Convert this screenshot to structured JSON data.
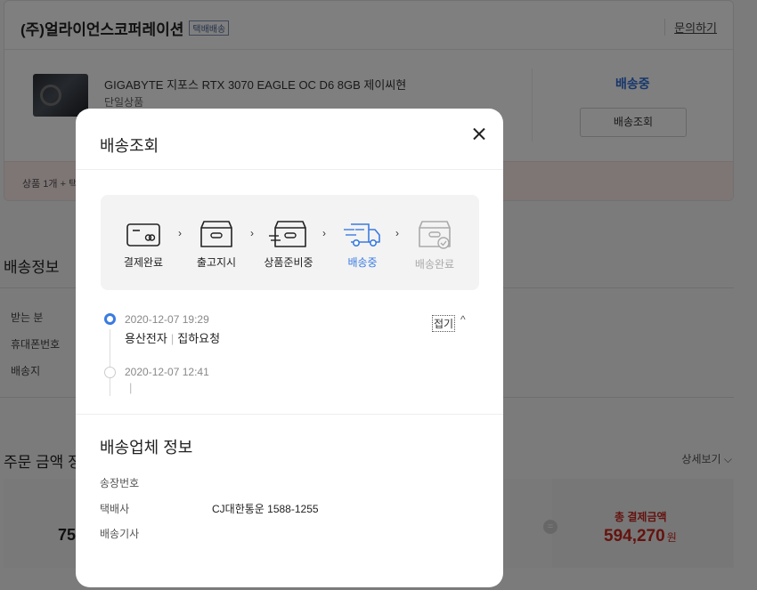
{
  "page": {
    "seller_name": "(주)얼라이언스코퍼레이션",
    "seller_badge": "택배배송",
    "inquiry_link": "문의하기",
    "product_name": "GIGABYTE 지포스 RTX 3070 EAGLE OC D6 8GB 제이씨현",
    "product_option": "단일상품",
    "shipping_status": "배송중",
    "tracking_button": "배송조회",
    "product_count_text": "상품 1개  + 택",
    "delivery_info_title": "배송정보",
    "delivery_labels": [
      "받는 분",
      "휴대폰번호",
      "배송지"
    ],
    "order_amount_title": "주문 금액 정",
    "detail_link": "상세보기 ⌵",
    "subtotal_partial": "75",
    "total_label": "총 결제금액",
    "total_value": "594,270",
    "total_unit": "원",
    "equals_symbol": "="
  },
  "modal": {
    "title": "배송조회",
    "steps": [
      {
        "label": "결제완료",
        "icon": "card-icon",
        "state": "done"
      },
      {
        "label": "출고지시",
        "icon": "box-icon",
        "state": "done"
      },
      {
        "label": "상품준비중",
        "icon": "box-prepare-icon",
        "state": "done"
      },
      {
        "label": "배송중",
        "icon": "truck-icon",
        "state": "active"
      },
      {
        "label": "배송완료",
        "icon": "box-check-icon",
        "state": "disabled"
      }
    ],
    "timeline": [
      {
        "datetime": "2020-12-07 19:29",
        "location": "용산전자",
        "status": "집하요청"
      },
      {
        "datetime": "2020-12-07 12:41",
        "location": "",
        "status": ""
      }
    ],
    "fold_label": "접기",
    "carrier_title": "배송업체 정보",
    "carrier": {
      "tracking_label": "송장번호",
      "tracking_value": "",
      "company_label": "택배사",
      "company_value": "CJ대한통운 1588-1255",
      "driver_label": "배송기사",
      "driver_value": ""
    }
  },
  "colors": {
    "accent": "#3b7be0",
    "total_red": "#c8261f"
  }
}
